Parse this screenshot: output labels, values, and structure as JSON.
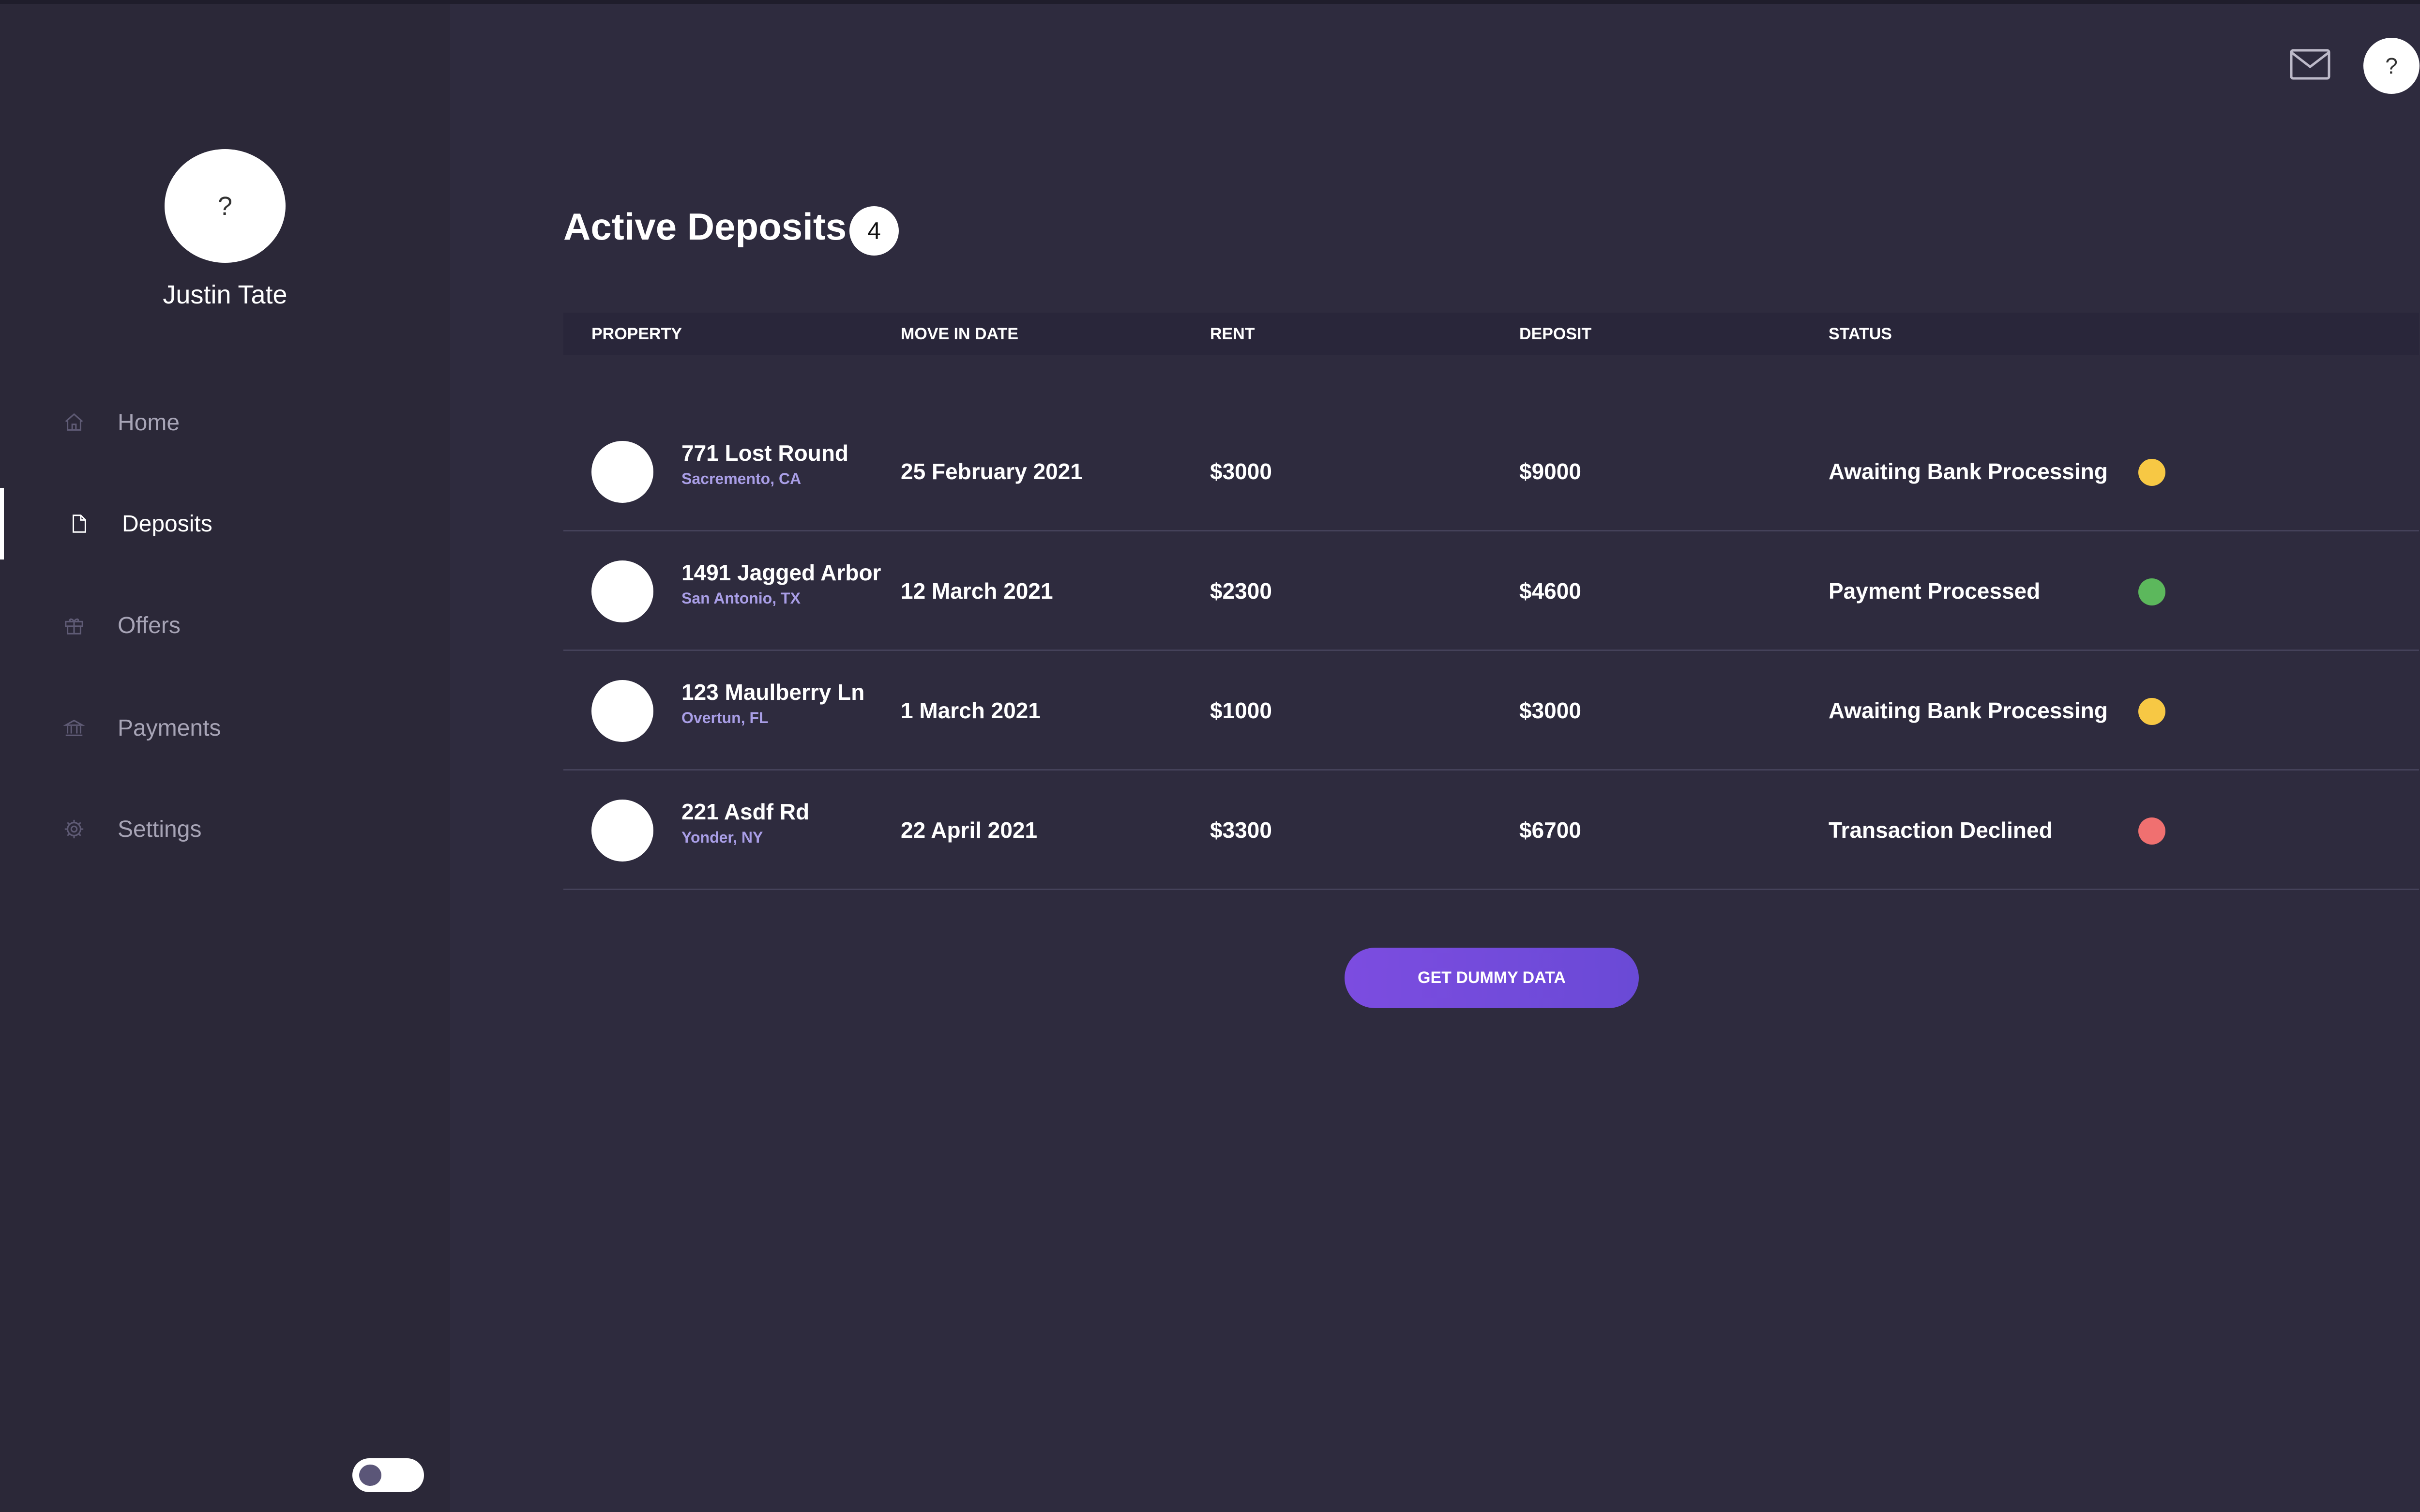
{
  "sidebar": {
    "avatar_placeholder": "?",
    "user_name": "Justin Tate",
    "items": [
      {
        "label": "Home",
        "icon": "home-icon",
        "active": false
      },
      {
        "label": "Deposits",
        "icon": "document-icon",
        "active": true
      },
      {
        "label": "Offers",
        "icon": "gift-icon",
        "active": false
      },
      {
        "label": "Payments",
        "icon": "bank-icon",
        "active": false
      },
      {
        "label": "Settings",
        "icon": "gear-icon",
        "active": false
      }
    ],
    "theme_toggle": {
      "on": false
    }
  },
  "header": {
    "mail_icon": "mail-icon",
    "help_label": "?"
  },
  "main": {
    "title": "Active Deposits",
    "count": "4",
    "columns": [
      "PROPERTY",
      "MOVE IN DATE",
      "RENT",
      "DEPOSIT",
      "STATUS"
    ],
    "rows": [
      {
        "address": "771 Lost Round",
        "city": "Sacremento, CA",
        "move_in": "25 February 2021",
        "rent": "$3000",
        "deposit": "$9000",
        "status": "Awaiting Bank Processing",
        "status_color": "#f7c844"
      },
      {
        "address": "1491 Jagged Arbor",
        "city": "San Antonio, TX",
        "move_in": "12 March 2021",
        "rent": "$2300",
        "deposit": "$4600",
        "status": "Payment Processed",
        "status_color": "#5cb85c"
      },
      {
        "address": "123 Maulberry Ln",
        "city": "Overtun, FL",
        "move_in": "1 March 2021",
        "rent": "$1000",
        "deposit": "$3000",
        "status": "Awaiting Bank Processing",
        "status_color": "#f7c844"
      },
      {
        "address": "221 Asdf Rd",
        "city": "Yonder, NY",
        "move_in": "22 April 2021",
        "rent": "$3300",
        "deposit": "$6700",
        "status": "Transaction Declined",
        "status_color": "#f07070"
      }
    ],
    "dummy_button_label": "GET DUMMY DATA"
  },
  "colors": {
    "background": "#2e2b3e",
    "accent": "#7c4ce0"
  }
}
